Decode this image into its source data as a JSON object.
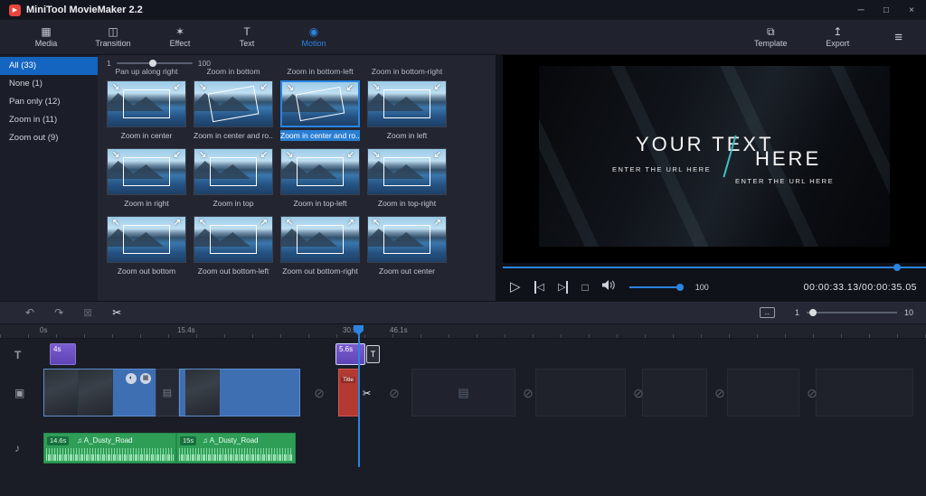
{
  "window": {
    "title": "MiniTool MovieMaker 2.2"
  },
  "icons": {
    "logo": "▶",
    "minimize": "─",
    "maximize": "□",
    "close": "×",
    "media": "▦",
    "transition": "◫",
    "effect": "✶",
    "text": "T",
    "motion": "◉",
    "template": "⧉",
    "export": "↥",
    "menu": "≡",
    "undo": "↶",
    "redo": "↷",
    "delete": "⊠",
    "scissors": "✂",
    "fit": "↔",
    "play": "▷",
    "prev_frame": "◁",
    "next_frame": "▷",
    "stop": "□",
    "music_note": "♫",
    "text_track": "T",
    "video_track": "▣",
    "music_track": "♪",
    "transition_placeholder": "⊘",
    "film": "▤",
    "film_add": "▤",
    "effect_badge": "◐",
    "motion_badge": "▦",
    "t_badge": "T"
  },
  "toolbar": {
    "tabs": [
      {
        "label": "Media",
        "icon": "media"
      },
      {
        "label": "Transition",
        "icon": "transition"
      },
      {
        "label": "Effect",
        "icon": "effect"
      },
      {
        "label": "Text",
        "icon": "text"
      },
      {
        "label": "Motion",
        "icon": "motion",
        "active": true
      }
    ],
    "right_tabs": [
      {
        "label": "Template",
        "icon": "template"
      },
      {
        "label": "Export",
        "icon": "export"
      }
    ]
  },
  "sidebar": {
    "items": [
      {
        "label": "All (33)",
        "selected": true
      },
      {
        "label": "None (1)"
      },
      {
        "label": "Pan only (12)"
      },
      {
        "label": "Zoom in (11)"
      },
      {
        "label": "Zoom out (9)"
      }
    ]
  },
  "motion_panel": {
    "duration_slider": {
      "min": "1",
      "max": "100"
    },
    "partial_labels": [
      "Pan up along right",
      "Zoom in bottom",
      "Zoom in bottom-left",
      "Zoom in bottom-right"
    ],
    "presets": [
      {
        "label": "Zoom in center"
      },
      {
        "label": "Zoom in center and ro...",
        "rotated": true
      },
      {
        "label": "Zoom in center and ro...",
        "rotated": true,
        "selected": true
      },
      {
        "label": "Zoom in left"
      },
      {
        "label": "Zoom in right"
      },
      {
        "label": "Zoom in top"
      },
      {
        "label": "Zoom in top-left"
      },
      {
        "label": "Zoom in top-right"
      },
      {
        "label": "Zoom out bottom"
      },
      {
        "label": "Zoom out bottom-left"
      },
      {
        "label": "Zoom out bottom-right"
      },
      {
        "label": "Zoom out center"
      }
    ]
  },
  "preview": {
    "title_line1": "YOUR TEXT",
    "title_line2": "HERE",
    "url_line1": "ENTER THE URL HERE",
    "url_line2": "ENTER THE URL HERE",
    "volume": "100",
    "timecode": "00:00:33.13/00:00:35.05"
  },
  "timeline_toolbar": {
    "zoom_min": "1",
    "zoom_max": "10"
  },
  "timeline": {
    "ruler_labels": [
      "0s",
      "15.4s",
      "30.5s",
      "46.1s"
    ],
    "text_clips": [
      {
        "label": "4s"
      },
      {
        "label": "5.6s"
      }
    ],
    "title_clip_label": "Title",
    "music_clips": [
      {
        "duration": "14.6s",
        "name": "A_Dusty_Road"
      },
      {
        "duration": "15s",
        "name": "A_Dusty_Road"
      }
    ]
  },
  "colors": {
    "accent": "#2a84e0",
    "sidebar_selected": "#1465c0",
    "text_clip": "#6f52c9",
    "music_clip": "#2e9e57",
    "title_clip": "#b23a32"
  }
}
